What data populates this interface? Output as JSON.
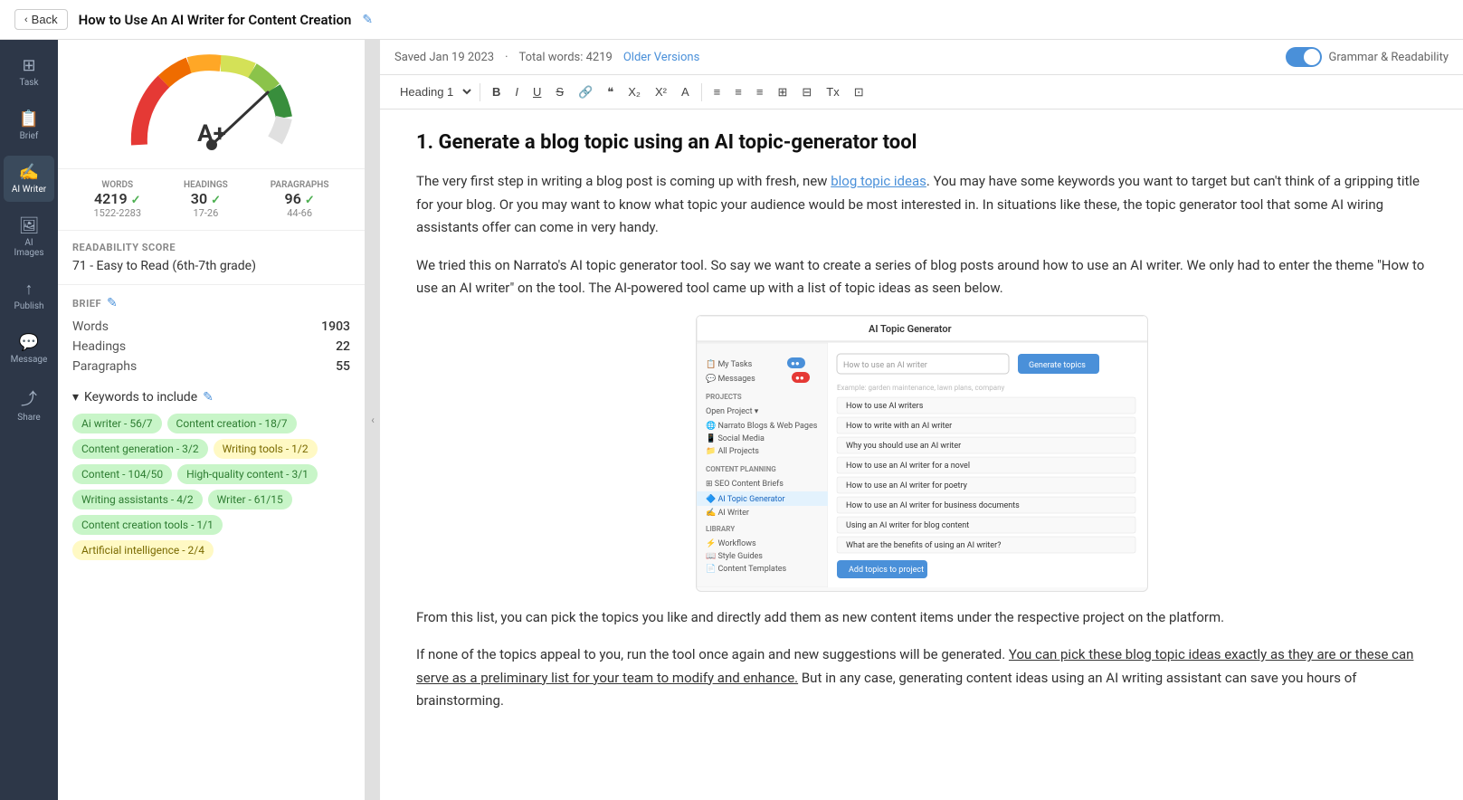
{
  "topBar": {
    "backLabel": "Back",
    "title": "How to Use An AI Writer for Content Creation",
    "editIcon": "✎"
  },
  "nav": {
    "items": [
      {
        "id": "task",
        "icon": "⊞",
        "label": "Task"
      },
      {
        "id": "brief",
        "icon": "📋",
        "label": "Brief"
      },
      {
        "id": "ai-writer",
        "icon": "✍",
        "label": "AI Writer",
        "active": true
      },
      {
        "id": "ai-images",
        "icon": "🖼",
        "label": "AI Images"
      },
      {
        "id": "publish",
        "icon": "↑",
        "label": "Publish"
      },
      {
        "id": "message",
        "icon": "💬",
        "label": "Message"
      },
      {
        "id": "share",
        "icon": "⤴",
        "label": "Share"
      }
    ]
  },
  "leftPanel": {
    "grade": "A+",
    "stats": {
      "words": {
        "label": "WORDS",
        "value": "4219",
        "range": "1522-2283"
      },
      "headings": {
        "label": "HEADINGS",
        "value": "30",
        "range": "17-26"
      },
      "paragraphs": {
        "label": "PARAGRAPHS",
        "value": "96",
        "range": "44-66"
      }
    },
    "readability": {
      "sectionLabel": "READABILITY SCORE",
      "score": "71 - Easy to Read (6th-7th grade)"
    },
    "brief": {
      "label": "BRIEF",
      "editIcon": "✎",
      "stats": [
        {
          "label": "Words",
          "value": "1903"
        },
        {
          "label": "Headings",
          "value": "22"
        },
        {
          "label": "Paragraphs",
          "value": "55"
        }
      ]
    },
    "keywords": {
      "toggleLabel": "Keywords to include",
      "editIcon": "✎",
      "items": [
        {
          "text": "Ai writer - 56/7",
          "style": "green"
        },
        {
          "text": "Content creation - 18/7",
          "style": "green"
        },
        {
          "text": "Content generation - 3/2",
          "style": "green"
        },
        {
          "text": "Writing tools - 1/2",
          "style": "yellow"
        },
        {
          "text": "Content - 104/50",
          "style": "green"
        },
        {
          "text": "High-quality content - 3/1",
          "style": "green"
        },
        {
          "text": "Writing assistants - 4/2",
          "style": "green"
        },
        {
          "text": "Writer - 61/15",
          "style": "green"
        },
        {
          "text": "Content creation tools - 1/1",
          "style": "green"
        },
        {
          "text": "Artificial intelligence - 2/4",
          "style": "yellow"
        }
      ]
    }
  },
  "editorMeta": {
    "saved": "Saved Jan 19 2023",
    "totalWords": "Total words: 4219",
    "olderVersions": "Older Versions",
    "grammarLabel": "Grammar & Readability"
  },
  "formatBar": {
    "headingSelect": "Heading 1 ÷",
    "buttons": [
      "B",
      "I",
      "U",
      "S",
      "🔗",
      "❝",
      "X₂",
      "X²",
      "A",
      "≋",
      "≡",
      "≡",
      "≡",
      "⊞",
      "⊟",
      "Tx",
      "⊡"
    ]
  },
  "content": {
    "h1": "1. Generate a blog topic using an AI topic-generator tool",
    "paragraphs": [
      "The very first step in writing a blog post is coming up with fresh, new blog topic ideas. You may have some keywords you want to target but can't think of a gripping title for your blog. Or you may want to know what topic your audience would be most interested in. In situations like these, the topic generator tool that some AI wiring assistants offer can come in very handy.",
      "We tried this on Narrato's AI topic generator tool. So say we want to create a series of blog posts around how to use an AI writer. We only had to enter the theme \"How to use an AI writer\" on the tool. The AI-powered tool came up with a list of topic ideas as seen below.",
      "From this list, you can pick the topics you like and directly add them as new content items under the respective project on the platform.",
      "If none of the topics appeal to you, run the tool once again and new suggestions will be generated. You can pick these blog topic ideas exactly as they are or these can serve as a preliminary list for your team to modify and enhance. But in any case, generating content ideas using an AI writing assistant can save you hours of brainstorming."
    ],
    "linkText": "blog topic ideas",
    "imagePlaceholder": "AI Topic Generator Screenshot"
  }
}
